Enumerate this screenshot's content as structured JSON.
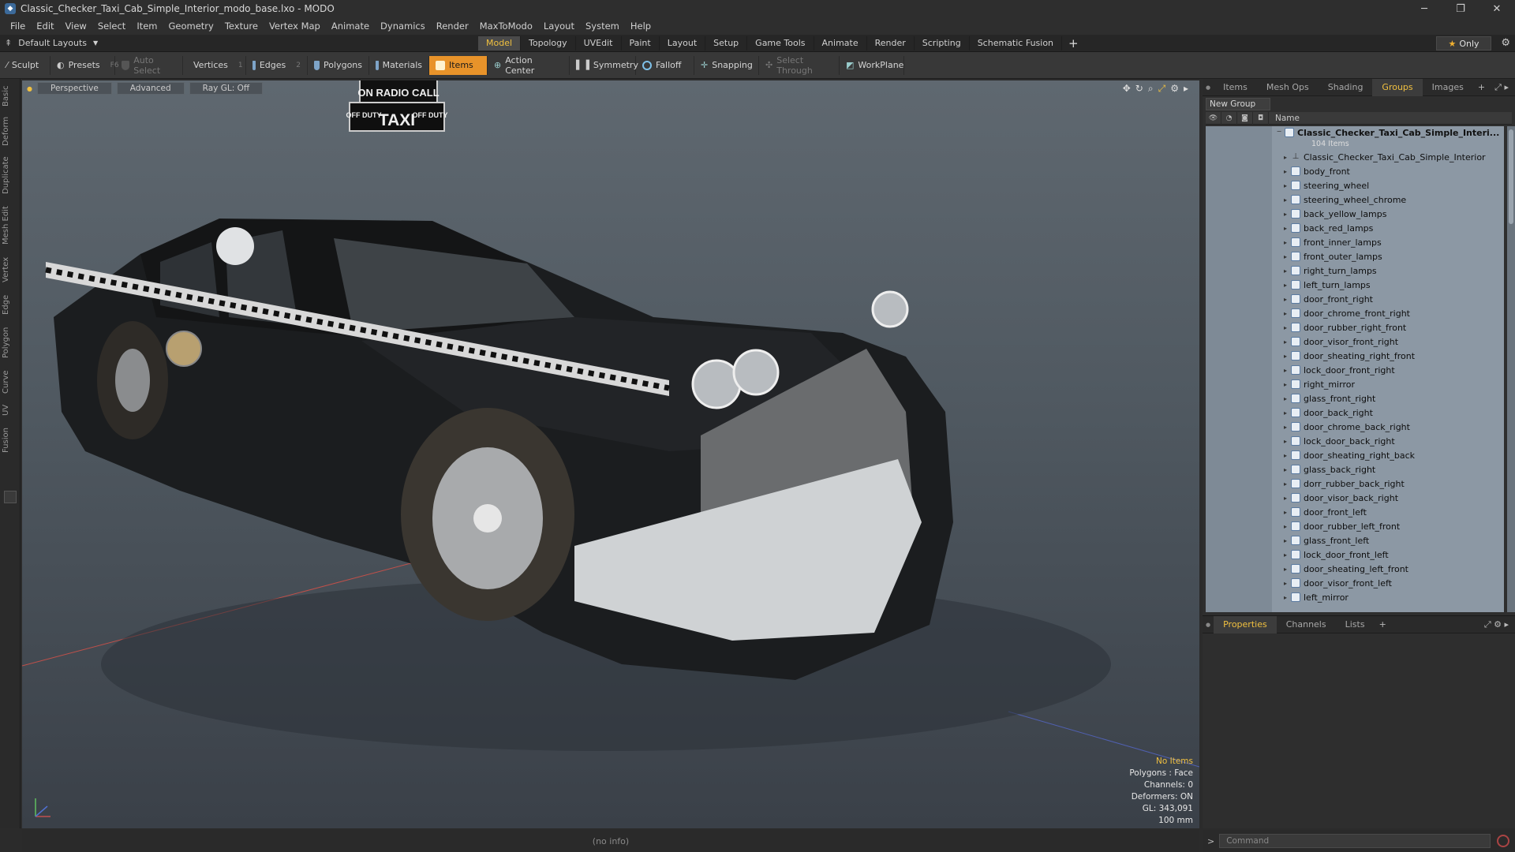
{
  "window": {
    "title": "Classic_Checker_Taxi_Cab_Simple_Interior_modo_base.lxo - MODO"
  },
  "menu": [
    "File",
    "Edit",
    "View",
    "Select",
    "Item",
    "Geometry",
    "Texture",
    "Vertex Map",
    "Animate",
    "Dynamics",
    "Render",
    "MaxToModo",
    "Layout",
    "System",
    "Help"
  ],
  "layout_selector": "Default Layouts",
  "mode_tabs": [
    "Model",
    "Topology",
    "UVEdit",
    "Paint",
    "Layout",
    "Setup",
    "Game Tools",
    "Animate",
    "Render",
    "Scripting",
    "Schematic Fusion"
  ],
  "active_tab": "Model",
  "only_label": "Only",
  "toolbar": {
    "sculpt": "Sculpt",
    "presets": "Presets",
    "presets_key": "F6",
    "auto_select": "Auto Select",
    "vertices": "Vertices",
    "vertices_num": "1",
    "edges": "Edges",
    "edges_num": "2",
    "polygons": "Polygons",
    "materials": "Materials",
    "items": "Items",
    "action_center": "Action Center",
    "symmetry": "Symmetry",
    "falloff": "Falloff",
    "snapping": "Snapping",
    "select_through": "Select Through",
    "workplane": "WorkPlane"
  },
  "side_tabs": [
    "Basic",
    "Deform",
    "Duplicate",
    "Mesh Edit",
    "Vertex",
    "Edge",
    "Polygon",
    "Curve",
    "UV",
    "Fusion"
  ],
  "viewport": {
    "view": "Perspective",
    "shading": "Advanced",
    "raygl": "Ray GL: Off",
    "hud": {
      "no_items": "No Items",
      "polygons": "Polygons : Face",
      "channels": "Channels: 0",
      "deformers": "Deformers: ON",
      "gl": "GL: 343,091",
      "scale": "100 mm"
    },
    "taxi_sign": [
      "ON RADIO CALL",
      "OFF DUTY",
      "TAXI",
      "OFF DUTY"
    ]
  },
  "status": "(no info)",
  "right_tabs": [
    "Items",
    "Mesh Ops",
    "Shading",
    "Groups",
    "Images"
  ],
  "active_right_tab": "Groups",
  "new_group": "New Group",
  "list_header": "Name",
  "group": {
    "name": "Classic_Checker_Taxi_Cab_Simple_Interi...",
    "count": "104 Items",
    "items": [
      "Classic_Checker_Taxi_Cab_Simple_Interior",
      "body_front",
      "steering_wheel",
      "steering_wheel_chrome",
      "back_yellow_lamps",
      "back_red_lamps",
      "front_inner_lamps",
      "front_outer_lamps",
      "right_turn_lamps",
      "left_turn_lamps",
      "door_front_right",
      "door_chrome_front_right",
      "door_rubber_right_front",
      "door_visor_front_right",
      "door_sheating_right_front",
      "lock_door_front_right",
      "right_mirror",
      "glass_front_right",
      "door_back_right",
      "door_chrome_back_right",
      "lock_door_back_right",
      "door_sheating_right_back",
      "glass_back_right",
      "dorr_rubber_back_right",
      "door_visor_back_right",
      "door_front_left",
      "door_rubber_left_front",
      "glass_front_left",
      "lock_door_front_left",
      "door_sheating_left_front",
      "door_visor_front_left",
      "left_mirror"
    ]
  },
  "bottom_tabs": [
    "Properties",
    "Channels",
    "Lists"
  ],
  "active_bottom_tab": "Properties",
  "command_placeholder": "Command"
}
